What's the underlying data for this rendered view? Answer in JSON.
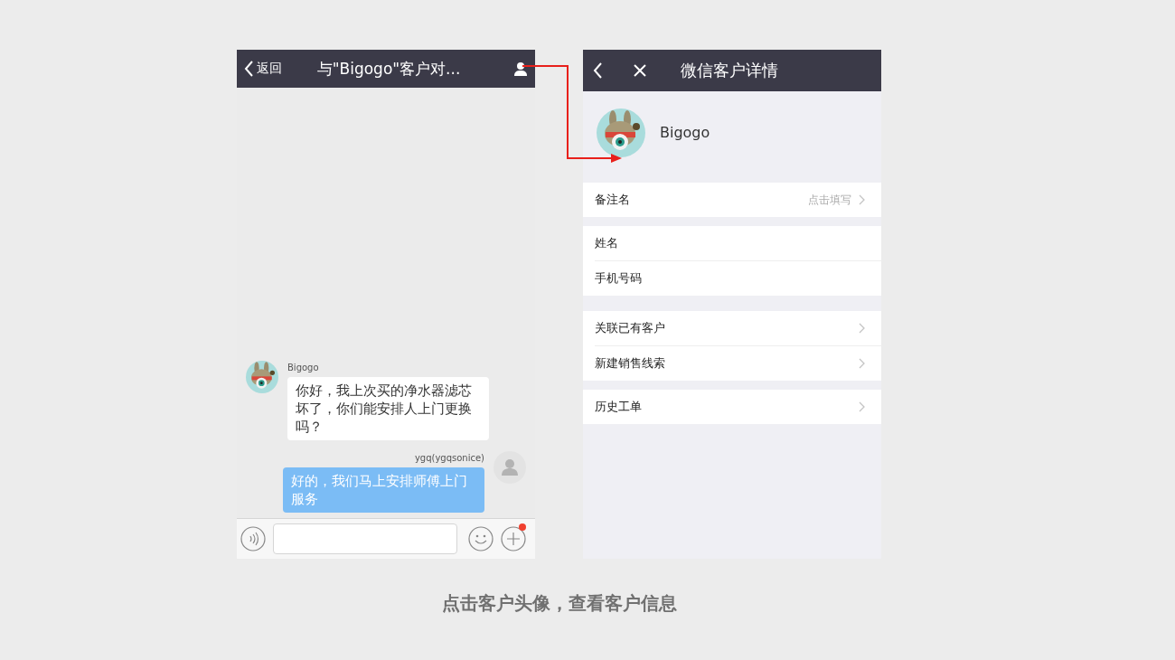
{
  "chat": {
    "back_label": "返回",
    "title": "与\"Bigogo\"客户对...",
    "messages": [
      {
        "kind": "incoming",
        "sender": "Bigogo",
        "text": "你好，我上次买的净水器滤芯坏了，你们能安排人上门更换吗？"
      },
      {
        "kind": "outgoing",
        "sender": "ygq(ygqsonice)",
        "text": "好的，我们马上安排师傅上门服务"
      }
    ],
    "plus_notification": true
  },
  "detail": {
    "title": "微信客户详情",
    "name": "Bigogo",
    "groups": [
      {
        "rows": [
          {
            "label": "备注名",
            "value": "点击填写",
            "chevron": true
          }
        ]
      },
      {
        "rows": [
          {
            "label": "姓名",
            "chevron": false
          },
          {
            "label": "手机号码",
            "chevron": false
          }
        ]
      },
      {
        "rows": [
          {
            "label": "关联已有客户",
            "chevron": true
          },
          {
            "label": "新建销售线索",
            "chevron": true
          }
        ]
      },
      {
        "rows": [
          {
            "label": "历史工单",
            "chevron": true
          }
        ]
      }
    ]
  },
  "caption": "点击客户头像，查看客户信息"
}
